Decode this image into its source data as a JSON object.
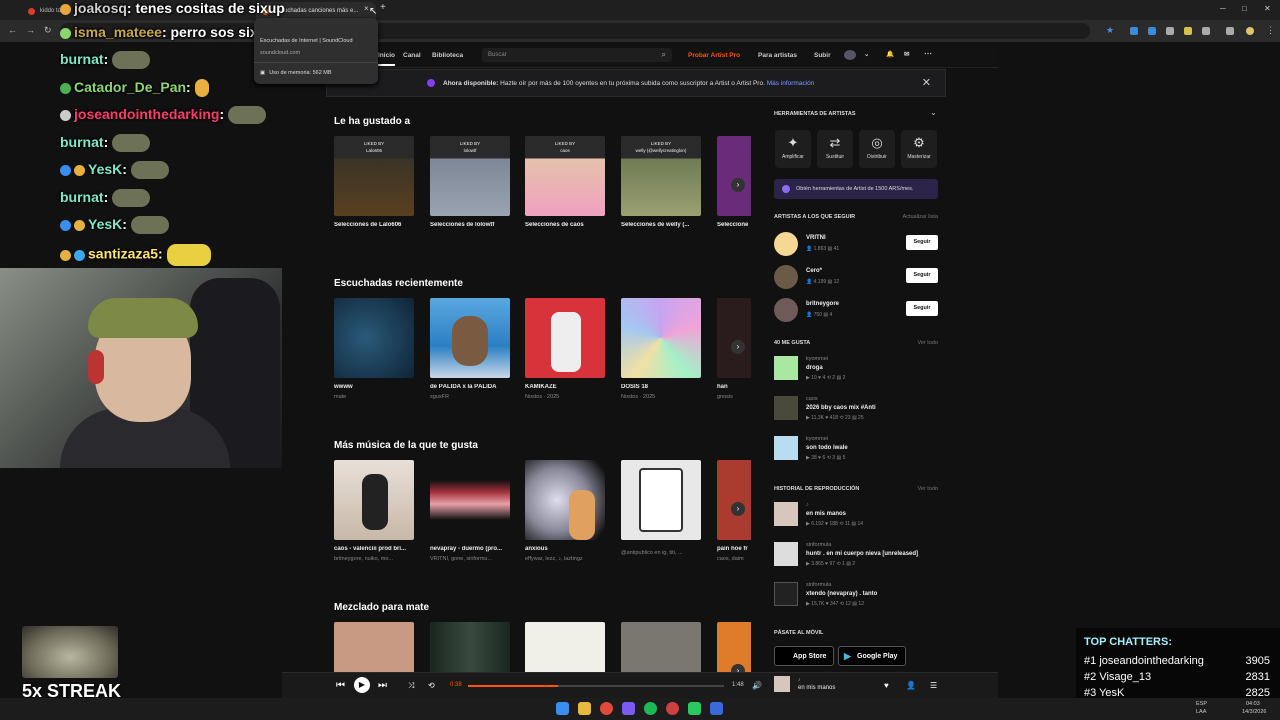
{
  "browser": {
    "tabs": [
      {
        "label": "kiddo toke",
        "color": "#e03a2f"
      },
      {
        "label": "Escuchadas canciones más e...",
        "color": "#f26f23"
      }
    ],
    "tab_close": "×",
    "new_tab": "+",
    "tooltip": {
      "title": "Escuchadas de Internet | SoundCloud",
      "domain": "soundcloud.com",
      "memory": "Uso de memoria: 562 MB"
    }
  },
  "chat": [
    {
      "user": "joakosq",
      "user_color": "#cfcfcf",
      "message": ": tenes cositas de sixup"
    },
    {
      "user": "isma_mateee",
      "user_color": "#c8a84a",
      "message": ": perro sos six up o decis"
    },
    {
      "user": "burnat",
      "user_color": "#7ee8c8",
      "message": ":"
    },
    {
      "user": "Catador_De_Pan",
      "user_color": "#8ad66e",
      "message": ":"
    },
    {
      "user": "joseandointhedarking",
      "user_color": "#ff3b6b",
      "message": ":"
    },
    {
      "user": "burnat",
      "user_color": "#7ee8c8",
      "message": ":"
    },
    {
      "user": "YesK",
      "user_color": "#7ee8c8",
      "message": ":"
    },
    {
      "user": "burnat",
      "user_color": "#7ee8c8",
      "message": ":"
    },
    {
      "user": "YesK",
      "user_color": "#7ee8c8",
      "message": ":"
    },
    {
      "user": "santizaza5",
      "user_color": "#ffe36b",
      "message": ":"
    }
  ],
  "soundcloud": {
    "nav": {
      "inicio": "Inicio",
      "canal": "Canal",
      "biblioteca": "Biblioteca",
      "search_placeholder": "Buscar",
      "probar": "Probar Artist Pro",
      "para_artistas": "Para artistas",
      "subir": "Subir"
    },
    "banner": {
      "strong": "Ahora disponible:",
      "text": "Hazte oír por más de 100 oyentes en tu próxima subida como suscriptor a Artist o Artist Pro.",
      "link": "Más información"
    },
    "sections": {
      "liked": {
        "title": "Le ha gustado a",
        "cards": [
          {
            "liked_by_label": "LIKED BY",
            "liked_by": "Lalo606",
            "title": "Selecciones de Lalo606",
            "subtitle": "",
            "color": "#3a3326"
          },
          {
            "liked_by_label": "LIKED BY",
            "liked_by": "lolowtf",
            "title": "Selecciones de lolowtf",
            "subtitle": "",
            "color": "#7d8797"
          },
          {
            "liked_by_label": "LIKED BY",
            "liked_by": "caos",
            "title": "Selecciones de caos",
            "subtitle": "",
            "color": "#e5c2ab"
          },
          {
            "liked_by_label": "LIKED BY",
            "liked_by": "welly (@wellycreatinglon)",
            "title": "Selecciones de welly (...",
            "subtitle": "",
            "color": "#6f7b54"
          },
          {
            "liked_by_label": "",
            "liked_by": "",
            "title": "Seleccione",
            "subtitle": "",
            "color": "#6a2c7a"
          }
        ]
      },
      "recent": {
        "title": "Escuchadas recientemente",
        "cards": [
          {
            "title": "wwww",
            "subtitle": "mate",
            "color": "#1d3a52"
          },
          {
            "title": "de PÁLIDA x la PÁLIDA",
            "subtitle": "sguxFR",
            "color": "#2b7fc3"
          },
          {
            "title": "KAMIKAZE",
            "subtitle": "Nostos · 2025",
            "color": "#d8333a"
          },
          {
            "title": "DOSIS 18",
            "subtitle": "Nostos · 2025",
            "color": "#b98ad8"
          },
          {
            "title": "han",
            "subtitle": "gnosis",
            "color": "#e2d9d2"
          }
        ]
      },
      "more": {
        "title": "Más música de la que te gusta",
        "cards": [
          {
            "title": "caos - valenciii prod bri...",
            "subtitle": "britneygore, nuiko, mo...",
            "color": "#d8cec2"
          },
          {
            "title": "nevapray - duermo (pro...",
            "subtitle": "VRITNI, gone, sinformu...",
            "color": "#a3303b"
          },
          {
            "title": "anxious",
            "subtitle": "effywar, lezz, ♪, laztingz",
            "color": "#b7bcc7"
          },
          {
            "title": "",
            "subtitle": "@antipublico en ig, titi, ...",
            "color": "#e8e8e8"
          },
          {
            "title": "pain hoe fr",
            "subtitle": "caos, daim",
            "color": "#ab3b2e"
          }
        ]
      },
      "mix": {
        "title": "Mezclado para mate",
        "cards": [
          {
            "color": "#c99a83"
          },
          {
            "color": "#2d3a33"
          },
          {
            "color": "#f0f0e8"
          },
          {
            "color": "#7a7670"
          },
          {
            "color": "#e07b2a"
          }
        ]
      }
    },
    "sidebar": {
      "tools_title": "HERRAMIENTAS DE ARTISTAS",
      "tools": [
        {
          "label": "Amplificar",
          "icon": "✦"
        },
        {
          "label": "Sustituir",
          "icon": "⇄"
        },
        {
          "label": "Distribuir",
          "icon": "◎"
        },
        {
          "label": "Masterizar",
          "icon": "⚙"
        }
      ],
      "promo": "Obtén herramientas de Artist de 1500 ARS/mes.",
      "follow_title": "ARTISTAS A LOS QUE SEGUIR",
      "follow_link": "Actualizar lista",
      "artists": [
        {
          "name": "VRITNI",
          "stats": "👤 1.863  ▤ 41",
          "button": "Seguir",
          "color": "#f4d894"
        },
        {
          "name": "Cero*",
          "stats": "👤 4.199  ▤ 12",
          "button": "Seguir",
          "color": "#6b5a47"
        },
        {
          "name": "britneygore",
          "stats": "👤 750  ▤ 4",
          "button": "Seguir",
          "color": "#6f5a5a"
        }
      ],
      "likes_title": "40 ME GUSTA",
      "likes_link": "Ver todo",
      "likes": [
        {
          "artist": "kyommei",
          "title": "droga",
          "stats": "▶ 10  ♥ 4  ⟲ 2  ▤ 2",
          "color": "#a8e8a0"
        },
        {
          "artist": "caos",
          "title": "2026 bby caos mix #Anti",
          "stats": "▶ 11,3K  ♥ 418  ⟲ 23  ▤ 25",
          "color": "#4a4a3a"
        },
        {
          "artist": "kyommei",
          "title": "son todo iwale",
          "stats": "▶ 38  ♥ 6  ⟲ 3  ▤ 5",
          "color": "#b8dcf0"
        }
      ],
      "history_title": "HISTORIAL DE REPRODUCCIÓN",
      "history_link": "Ver todo",
      "history": [
        {
          "artist": "♪",
          "title": "en mis manos",
          "stats": "▶ 6.192  ♥ 188  ⟲ 11  ▤ 14",
          "color": "#d6c6bc"
        },
        {
          "artist": "sinformula",
          "title": "huntr . en mi cuerpo nieva [unreleased]",
          "stats": "▶ 3.865  ♥ 97  ⟲ 1  ▤ 2",
          "color": "#ddd"
        },
        {
          "artist": "sinformula",
          "title": "xtendo (nevapray) . tanto",
          "stats": "▶ 15,7K  ♥ 347  ⟲ 12  ▤ 12",
          "color": "#222"
        }
      ],
      "mobile_title": "PÁSATE AL MÓVIL",
      "app_store": "App Store",
      "google_play": "Google Play"
    },
    "player": {
      "elapsed": "0:38",
      "duration": "1:48",
      "progress": 0.35,
      "track_artist": "♪",
      "track_title": "en mis manos"
    }
  },
  "overlay": {
    "streak": "5x STREAK",
    "top_chatters_title": "TOP CHATTERS:",
    "top_chatters": [
      {
        "rank": "#1",
        "name": "joseandointhedarking",
        "count": "3905"
      },
      {
        "rank": "#2",
        "name": "Visage_13",
        "count": "2831"
      },
      {
        "rank": "#3",
        "name": "YesK",
        "count": "2825"
      }
    ]
  },
  "taskbar": {
    "lang": "ESP",
    "lang2": "LAA",
    "time": "04:03",
    "date": "14/3/2026"
  }
}
